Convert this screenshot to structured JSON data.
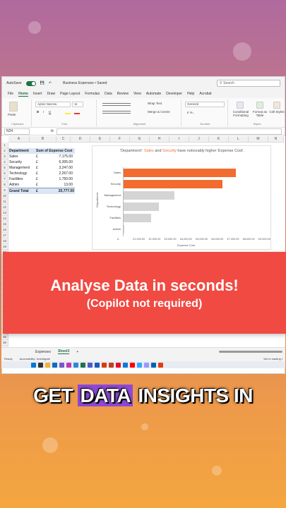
{
  "window": {
    "autosave_label": "AutoSave",
    "toggle_label": "On",
    "file_title": "Business Expenses • Saved",
    "search_placeholder": "Search"
  },
  "menu": [
    "File",
    "Home",
    "Insert",
    "Draw",
    "Page Layout",
    "Formulas",
    "Data",
    "Review",
    "View",
    "Automate",
    "Developer",
    "Help",
    "Acrobat"
  ],
  "ribbon": {
    "paste": "Paste",
    "font_name": "Aptos Narrow",
    "font_size": "11",
    "wrap_text": "Wrap Text",
    "merge_centre": "Merge & Centre",
    "number_format": "General",
    "conditional_formatting": "Conditional Formatting",
    "format_as_table": "Format as Table",
    "cell_styles": "Cell Styles",
    "groups": [
      "Clipboard",
      "Font",
      "Alignment",
      "Number",
      "Styles"
    ]
  },
  "formula_bar": {
    "name_box": "N24",
    "fx": "fx"
  },
  "columns": [
    "A",
    "B",
    "C",
    "D",
    "E",
    "F",
    "G",
    "H",
    "I",
    "J",
    "K",
    "L",
    "M",
    "N"
  ],
  "pivot": {
    "header_dept": "Department",
    "header_sum": "Sum of Expense Cost",
    "currency": "£",
    "rows": [
      {
        "dept": "Sales",
        "value": "7,175.00"
      },
      {
        "dept": "Security",
        "value": "6,305.00"
      },
      {
        "dept": "Management",
        "value": "3,247.00"
      },
      {
        "dept": "Technology",
        "value": "2,267.00"
      },
      {
        "dept": "Facilities",
        "value": "1,750.00"
      },
      {
        "dept": "Admin",
        "value": "13.00"
      }
    ],
    "total_label": "Grand Total",
    "total_value": "20,777.00"
  },
  "chart_data": {
    "type": "bar",
    "orientation": "horizontal",
    "title_parts": [
      "'Department': ",
      "Sales",
      " and ",
      "Security",
      " have noticeably higher 'Expense Cost'."
    ],
    "categories": [
      "Sales",
      "Security",
      "Management",
      "Technology",
      "Facilities",
      "Admin"
    ],
    "values": [
      7175,
      6305,
      3247,
      2267,
      1750,
      13
    ],
    "highlight_color": "#f26b2f",
    "muted_color": "#d4d4d4",
    "xlim": [
      0,
      9000
    ],
    "xticks": [
      "£-",
      "£1,000.00",
      "£2,000.00",
      "£3,000.00",
      "£4,000.00",
      "£5,000.00",
      "£6,000.00",
      "£7,000.00",
      "£8,000.00",
      "£9,000.00"
    ],
    "xlabel": "Expense Cost",
    "ylabel": "Department",
    "grid": false
  },
  "banner": {
    "line1": "Analyse Data in seconds!",
    "line2": "(Copilot not required)"
  },
  "sheets": [
    "Expenses",
    "Sheet3"
  ],
  "add_sheet": "+",
  "status": {
    "ready": "Ready",
    "accessibility": "Accessibility: Investigate",
    "notice": "We're starting t"
  },
  "caption": {
    "pre": "GET ",
    "highlight": "DATA",
    "post": " INSIGHTS IN"
  }
}
